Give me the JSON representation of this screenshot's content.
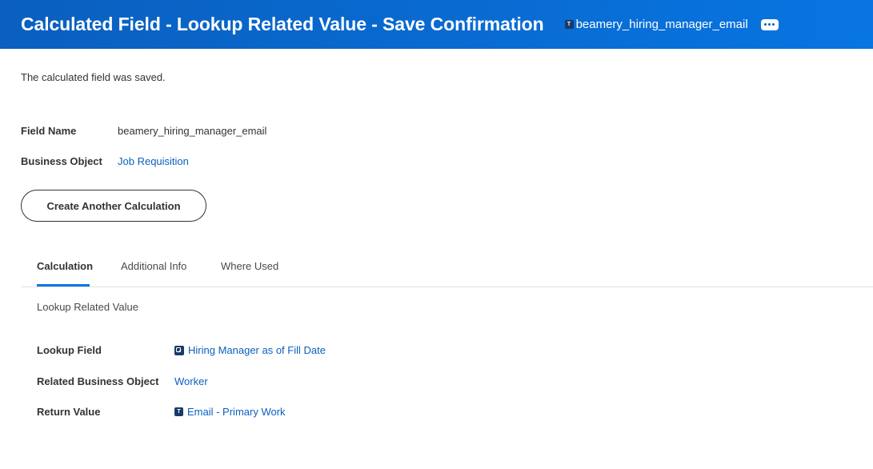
{
  "header": {
    "title": "Calculated Field - Lookup Related Value - Save Confirmation",
    "field_tag": "beamery_hiring_manager_email",
    "field_type_letter": "T",
    "more_icon": "ellipsis-icon"
  },
  "message": "The calculated field was saved.",
  "summary": {
    "field_name_label": "Field Name",
    "field_name_value": "beamery_hiring_manager_email",
    "business_object_label": "Business Object",
    "business_object_value": "Job Requisition"
  },
  "create_button_label": "Create Another Calculation",
  "tabs": [
    {
      "label": "Calculation",
      "active": true
    },
    {
      "label": "Additional Info",
      "active": false
    },
    {
      "label": "Where Used",
      "active": false
    }
  ],
  "calculation": {
    "subtitle": "Lookup Related Value",
    "lookup_field_label": "Lookup Field",
    "lookup_field_value": "Hiring Manager as of Fill Date",
    "related_bo_label": "Related Business Object",
    "related_bo_value": "Worker",
    "return_value_label": "Return Value",
    "return_value_value": "Email - Primary Work",
    "return_value_type_letter": "T"
  },
  "colors": {
    "header_bg": "#0875e1",
    "link": "#0b5fbf",
    "tab_active_underline": "#0875e1"
  }
}
